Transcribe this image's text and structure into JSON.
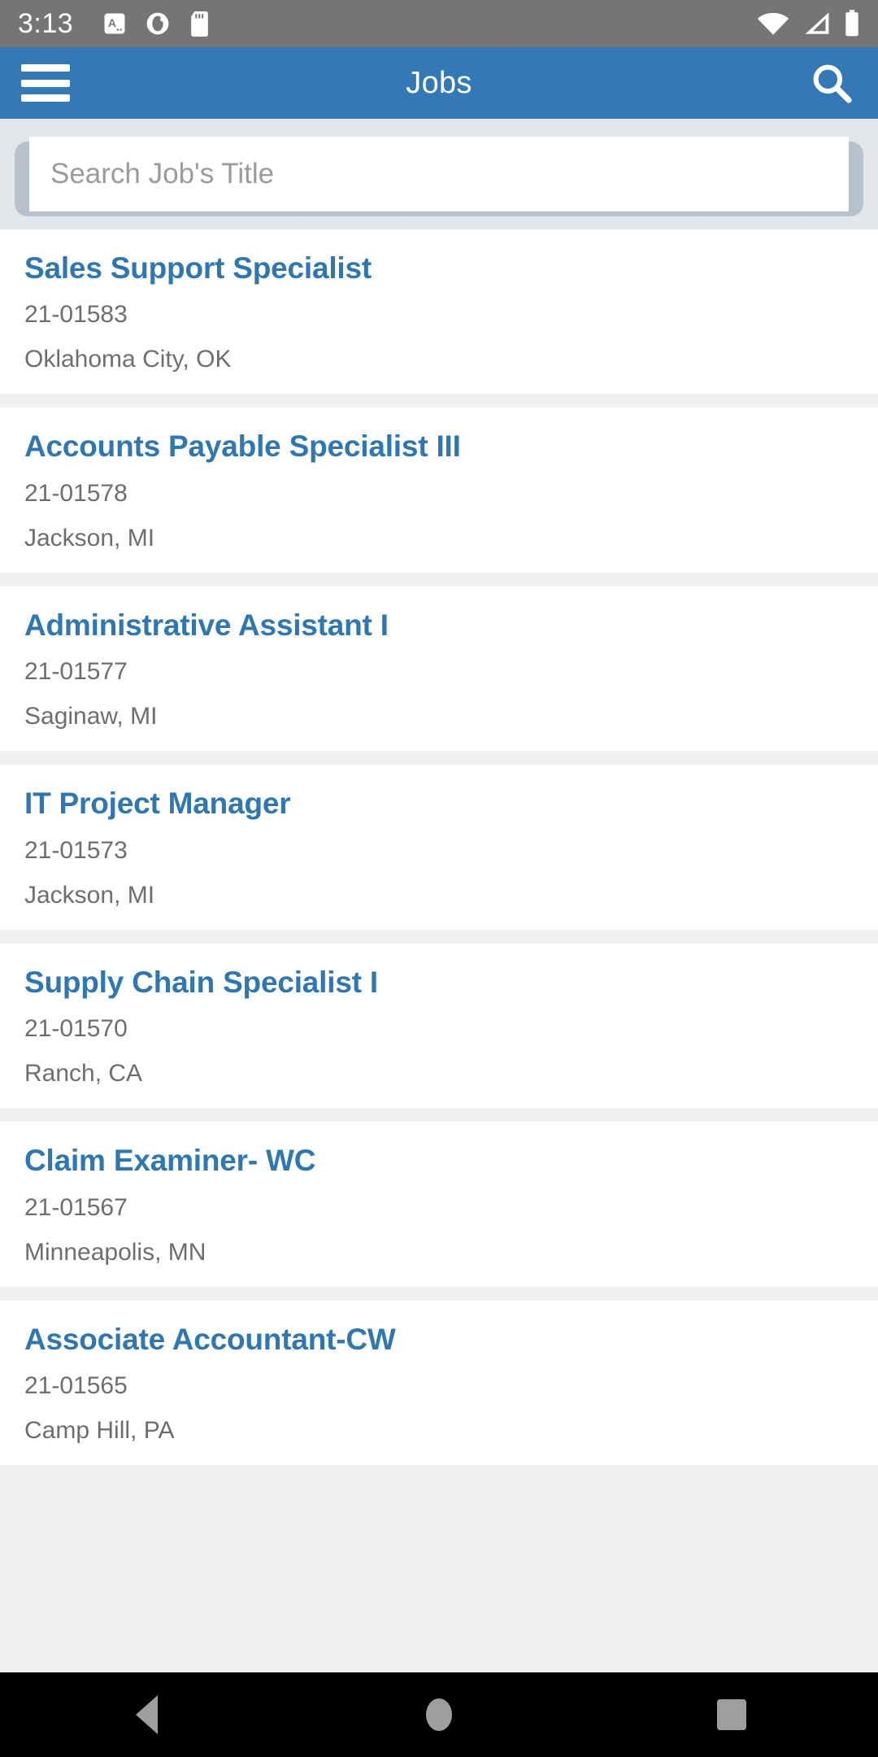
{
  "status_bar": {
    "time": "3:13",
    "left_icons": [
      "font-size-a-icon",
      "data-saver-icon",
      "sd-card-icon"
    ],
    "right_icons": [
      "wifi-icon",
      "cellular-signal-icon",
      "battery-icon"
    ],
    "background_color": "#757575"
  },
  "app_bar": {
    "title": "Jobs",
    "menu_icon": "hamburger-menu-icon",
    "search_icon": "search-icon",
    "background_color": "#3479B7",
    "text_color": "#FFFFFF"
  },
  "search": {
    "placeholder": "Search Job's Title",
    "value": "",
    "container_color": "#E3E7EC",
    "field_color": "#FFFFFF"
  },
  "list": {
    "accent_color": "#2E77B3",
    "meta_color": "#6E6E6E",
    "background_color": "#EEF0F2",
    "jobs": [
      {
        "title": "Sales Support Specialist",
        "number": "21-01583",
        "location": "Oklahoma City, OK"
      },
      {
        "title": "Accounts Payable Specialist III",
        "number": "21-01578",
        "location": "Jackson, MI"
      },
      {
        "title": "Administrative Assistant I",
        "number": "21-01577",
        "location": "Saginaw, MI"
      },
      {
        "title": "IT Project Manager",
        "number": "21-01573",
        "location": "Jackson, MI"
      },
      {
        "title": "Supply Chain Specialist I",
        "number": "21-01570",
        "location": "Ranch, CA"
      },
      {
        "title": "Claim Examiner- WC",
        "number": "21-01567",
        "location": "Minneapolis, MN"
      },
      {
        "title": "Associate Accountant-CW",
        "number": "21-01565",
        "location": "Camp Hill, PA"
      }
    ]
  },
  "nav_bar": {
    "back_icon": "back-triangle-icon",
    "home_icon": "home-circle-icon",
    "recents_icon": "recents-square-icon",
    "background_color": "#000000",
    "icon_color": "#9E9E9E"
  }
}
